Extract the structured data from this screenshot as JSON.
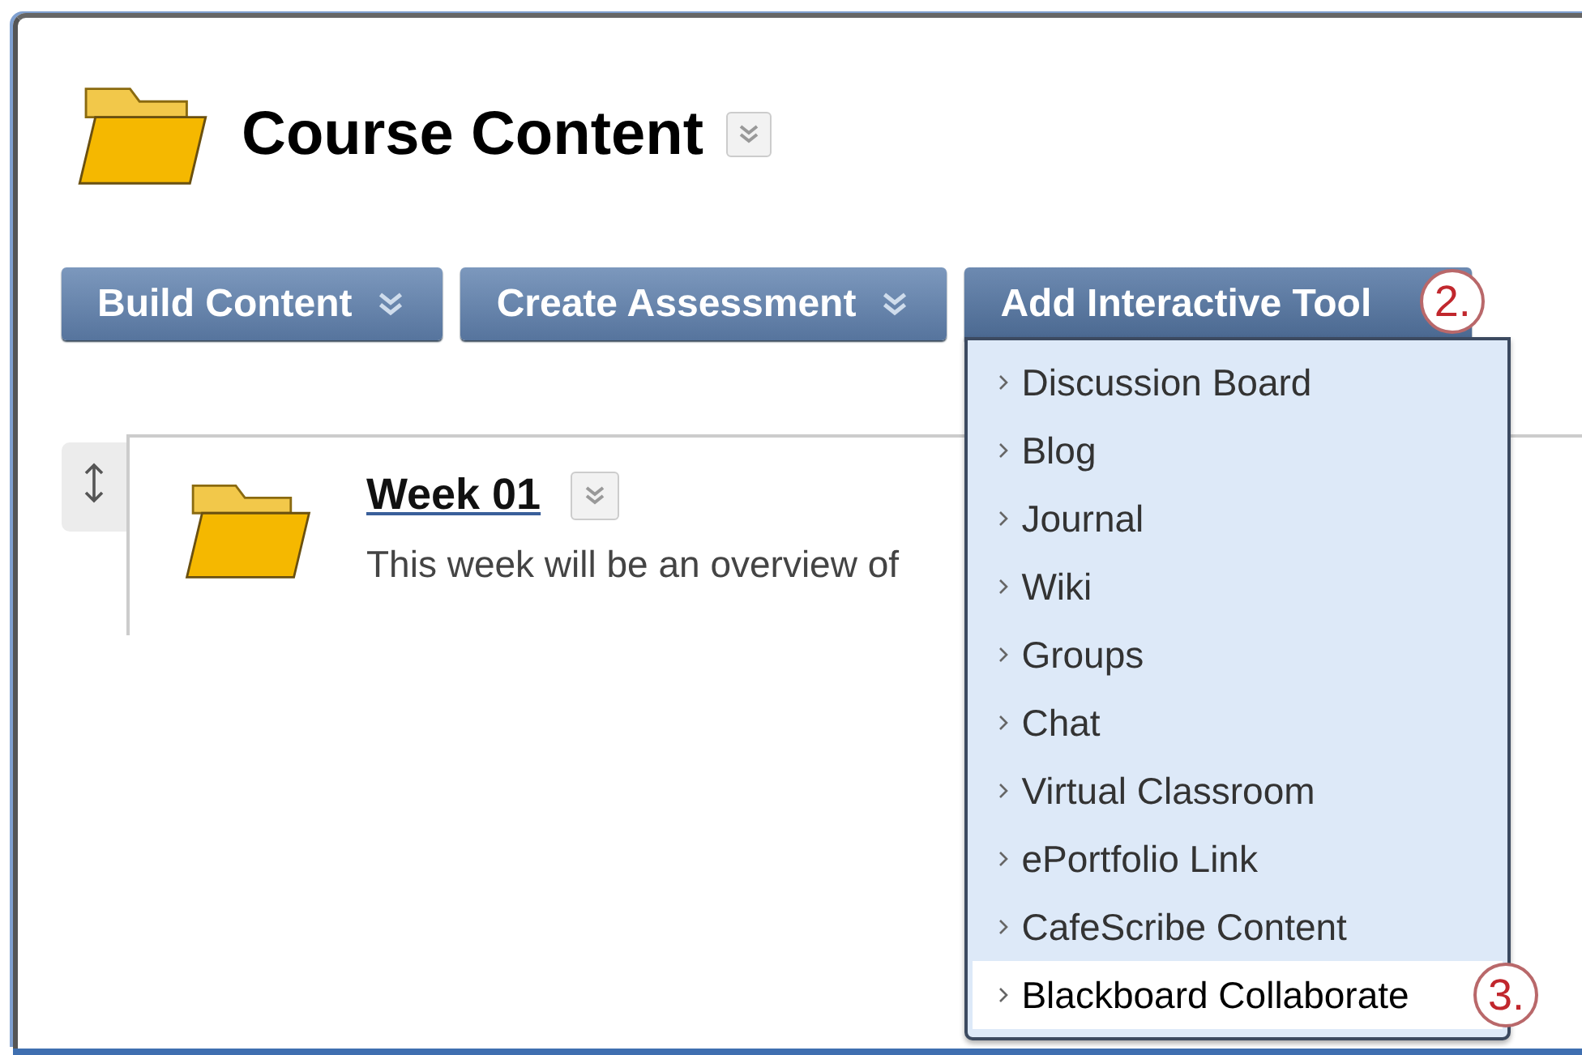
{
  "page": {
    "title": "Course Content"
  },
  "toolbar": [
    {
      "label": "Build Content",
      "open": false
    },
    {
      "label": "Create Assessment",
      "open": false
    },
    {
      "label": "Add Interactive Tool",
      "open": true,
      "callout": "2."
    }
  ],
  "menu": {
    "items": [
      {
        "label": "Discussion Board",
        "selected": false
      },
      {
        "label": "Blog",
        "selected": false
      },
      {
        "label": "Journal",
        "selected": false
      },
      {
        "label": "Wiki",
        "selected": false
      },
      {
        "label": "Groups",
        "selected": false
      },
      {
        "label": "Chat",
        "selected": false
      },
      {
        "label": "Virtual Classroom",
        "selected": false
      },
      {
        "label": "ePortfolio Link",
        "selected": false
      },
      {
        "label": "CafeScribe Content",
        "selected": false
      },
      {
        "label": "Blackboard Collaborate",
        "selected": true,
        "callout": "3."
      }
    ]
  },
  "content_items": [
    {
      "title": "Week 01",
      "description": "This week will be an overview of"
    }
  ]
}
